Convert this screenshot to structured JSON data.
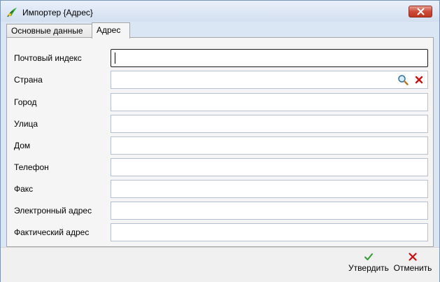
{
  "window": {
    "title": "Импортер {Адрес}"
  },
  "tabs": [
    {
      "label": "Основные данные",
      "active": false
    },
    {
      "label": "Адрес",
      "active": true
    }
  ],
  "fields": [
    {
      "label": "Почтовый индекс",
      "value": ""
    },
    {
      "label": "Страна",
      "value": ""
    },
    {
      "label": "Город",
      "value": ""
    },
    {
      "label": "Улица",
      "value": ""
    },
    {
      "label": "Дом",
      "value": ""
    },
    {
      "label": "Телефон",
      "value": ""
    },
    {
      "label": "Факс",
      "value": ""
    },
    {
      "label": "Электронный адрес",
      "value": ""
    },
    {
      "label": "Фактический адрес",
      "value": ""
    }
  ],
  "buttons": {
    "confirm": "Утвердить",
    "cancel": "Отменить"
  },
  "colors": {
    "confirm_icon": "#2f9e2f",
    "cancel_icon": "#d01010",
    "close_button": "#c0381f"
  },
  "icons": {
    "app": "importer-icon",
    "search": "magnifier-icon",
    "clear": "red-x-icon"
  }
}
